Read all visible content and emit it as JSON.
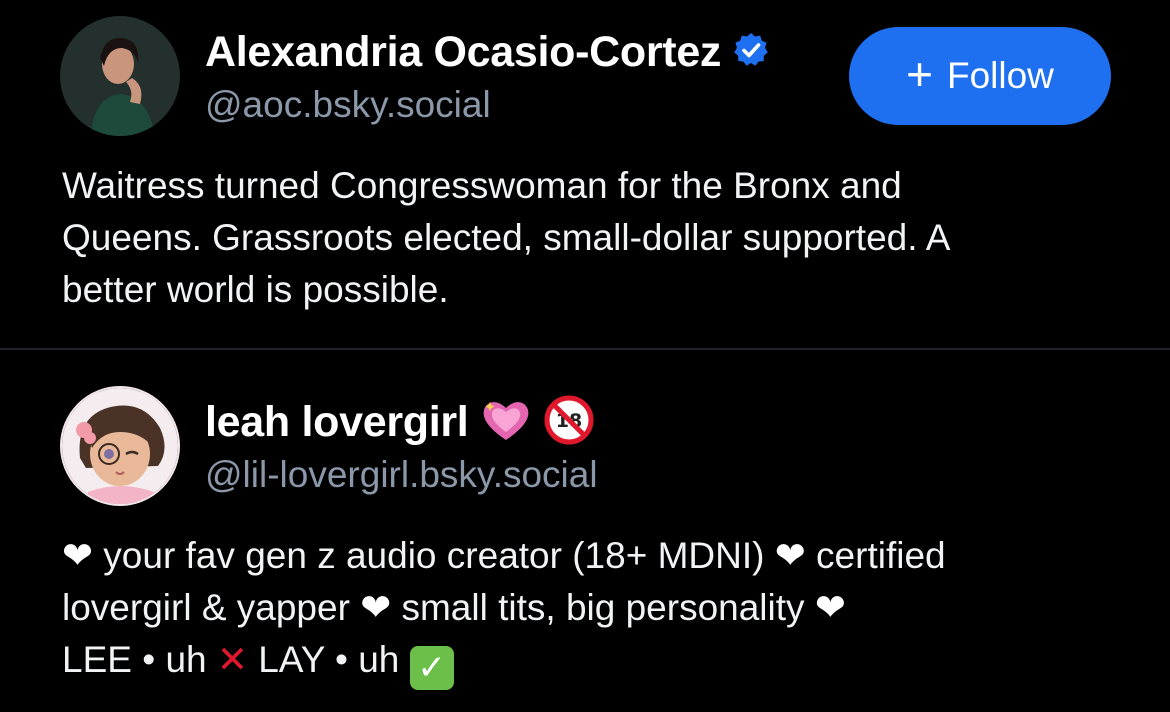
{
  "profiles": [
    {
      "display_name": "Alexandria Ocasio-Cortez",
      "handle": "@aoc.bsky.social",
      "verified_icon": "verified-check-icon",
      "follow": {
        "plus": "+",
        "label": "Follow"
      },
      "bio_lines": [
        "Waitress turned Congresswoman for the Bronx and",
        "Queens. Grassroots elected, small-dollar supported. A",
        "better world is possible."
      ]
    },
    {
      "display_name": "leah lovergirl",
      "handle": "@lil-lovergirl.bsky.social",
      "name_badges": [
        "sparkling-heart-icon",
        "no-one-under-18-icon"
      ],
      "bio": {
        "line1_a": "your fav gen z audio creator (18+ MDNI)",
        "line1_b": "certified",
        "line2_a": "lovergirl & yapper",
        "line2_b": "small tits, big personality",
        "line3_a": "LEE • uh",
        "line3_b": "LAY • uh"
      }
    }
  ],
  "colors": {
    "background": "#000000",
    "follow_button": "#1f6ff1",
    "handle_text": "#8b98a9",
    "verified": "#1f6ff1"
  }
}
